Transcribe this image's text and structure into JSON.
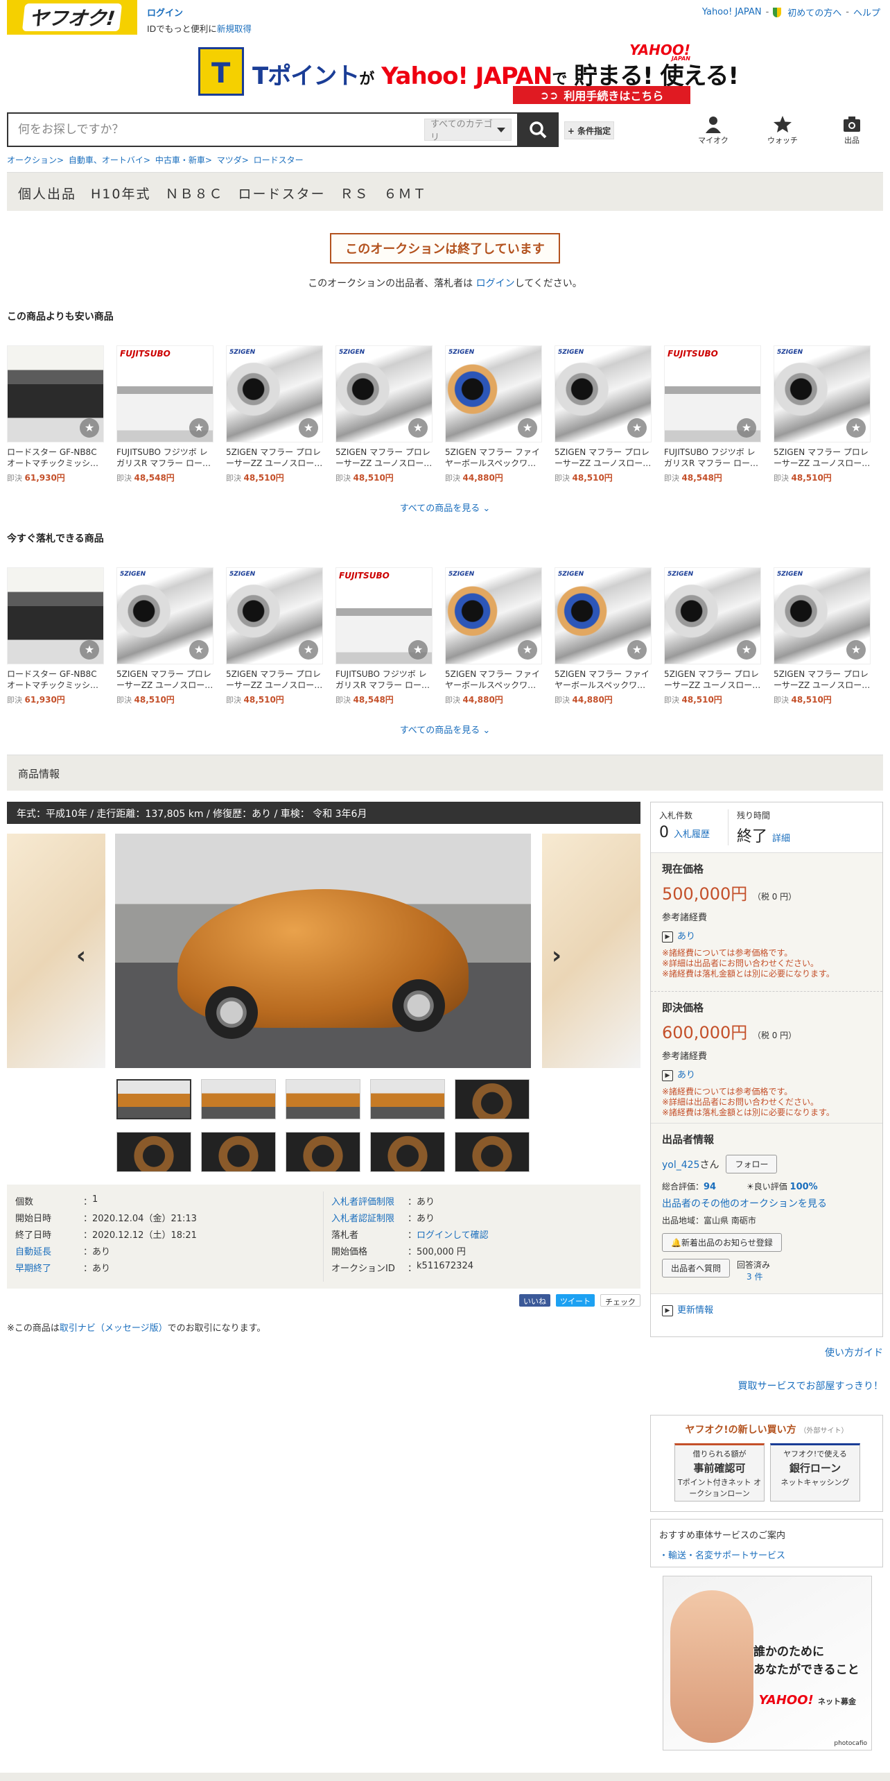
{
  "header": {
    "logo": "ヤフオク!",
    "login": "ログイン",
    "login_sub_prefix": "IDでもっと便利に",
    "login_sub_link": "新規取得",
    "top_links": [
      "Yahoo! JAPAN",
      "初めての方へ",
      "ヘルプ"
    ]
  },
  "banner": {
    "tpoint": "Tポイント",
    "ga": "が",
    "yj": "Yahoo! JAPAN",
    "de": "で",
    "tamaru": "貯まる! 使える!",
    "logo": "YAHOO!",
    "logo_sub": "JAPAN",
    "button": "利用手続きはこちら"
  },
  "search": {
    "placeholder": "何をお探しですか？",
    "category": "すべてのカテゴリ",
    "conditions": "+ 条件指定"
  },
  "nav": {
    "myauc": "マイオク",
    "watch": "ウォッチ",
    "sell": "出品"
  },
  "breadcrumbs": [
    "オークション",
    "自動車、オートバイ",
    "中古車・新車",
    "マツダ",
    "ロードスター"
  ],
  "title": "個人出品　H10年式　ＮＢ８Ｃ　ロードスター　ＲＳ　６ＭＴ",
  "ended": "このオークションは終了しています",
  "ended_note_prefix": "このオークションの出品者、落札者は",
  "ended_note_link": "ログイン",
  "ended_note_suffix": "してください。",
  "cheaper": {
    "heading": "この商品よりも安い商品",
    "more": "すべての商品を見る",
    "items": [
      {
        "title": "ロードスター GF-NB8C オートマチックミッシ…",
        "price": "61,930円",
        "art": "engine"
      },
      {
        "title": "FUJITSUBO フジツボ レガリスR マフラー ロー…",
        "price": "48,548円",
        "art": "fuji"
      },
      {
        "title": "5ZIGEN マフラー プロレーサーZZ ユーノスロー…",
        "price": "48,510円",
        "art": "muff"
      },
      {
        "title": "5ZIGEN マフラー プロレーサーZZ ユーノスロー…",
        "price": "48,510円",
        "art": "muff"
      },
      {
        "title": "5ZIGEN マフラー ファイヤーボールスペックワ…",
        "price": "44,880円",
        "art": "ti"
      },
      {
        "title": "5ZIGEN マフラー プロレーサーZZ ユーノスロー…",
        "price": "48,510円",
        "art": "muff"
      },
      {
        "title": "FUJITSUBO フジツボ レガリスR マフラー ロー…",
        "price": "48,548円",
        "art": "fuji"
      },
      {
        "title": "5ZIGEN マフラー プロレーサーZZ ユーノスロー…",
        "price": "48,510円",
        "art": "muff"
      }
    ]
  },
  "buynow": {
    "heading": "今すぐ落札できる商品",
    "more": "すべての商品を見る",
    "items": [
      {
        "title": "ロードスター GF-NB8C オートマチックミッシ…",
        "price": "61,930円",
        "art": "engine"
      },
      {
        "title": "5ZIGEN マフラー プロレーサーZZ ユーノスロー…",
        "price": "48,510円",
        "art": "muff"
      },
      {
        "title": "5ZIGEN マフラー プロレーサーZZ ユーノスロー…",
        "price": "48,510円",
        "art": "muff"
      },
      {
        "title": "FUJITSUBO フジツボ レガリスR マフラー ロー…",
        "price": "48,548円",
        "art": "fuji"
      },
      {
        "title": "5ZIGEN マフラー ファイヤーボールスペックワ…",
        "price": "44,880円",
        "art": "ti"
      },
      {
        "title": "5ZIGEN マフラー ファイヤーボールスペックワ…",
        "price": "44,880円",
        "art": "ti"
      },
      {
        "title": "5ZIGEN マフラー プロレーサーZZ ユーノスロー…",
        "price": "48,510円",
        "art": "muff"
      },
      {
        "title": "5ZIGEN マフラー プロレーサーZZ ユーノスロー…",
        "price": "48,510円",
        "art": "muff"
      }
    ]
  },
  "sokketsu": "即決",
  "info": {
    "heading": "商品情報",
    "spec": "年式：平成10年 / 走行距離：137,805 km / 修復歴：あり / 車検： 令和 3年6月",
    "left": [
      {
        "k": "個数",
        "v": "1",
        "link": false
      },
      {
        "k": "開始日時",
        "v": "2020.12.04（金）21:13",
        "link": false
      },
      {
        "k": "終了日時",
        "v": "2020.12.12（土）18:21",
        "link": false
      },
      {
        "k": "自動延長",
        "v": "あり",
        "link": true
      },
      {
        "k": "早期終了",
        "v": "あり",
        "link": true
      }
    ],
    "right": [
      {
        "k": "入札者評価制限",
        "v": "あり",
        "link": true,
        "vlink": false
      },
      {
        "k": "入札者認証制限",
        "v": "あり",
        "link": true,
        "vlink": false
      },
      {
        "k": "落札者",
        "v": "ログインして確認",
        "link": false,
        "vlink": true
      },
      {
        "k": "開始価格",
        "v": "500,000 円",
        "link": false,
        "vlink": false
      },
      {
        "k": "オークションID",
        "v": "k511672324",
        "link": false,
        "vlink": false
      }
    ],
    "social": [
      "いいね",
      "ツイート",
      "チェック"
    ],
    "note_prefix": "※この商品は",
    "note_link": "取引ナビ（メッセージ版）",
    "note_suffix": "でのお取引になります。"
  },
  "panel": {
    "bids_label": "入札件数",
    "bids": "0",
    "bid_history": "入札履歴",
    "remain_label": "残り時間",
    "remain": "終了",
    "detail": "詳細",
    "current_label": "現在価格",
    "current_price": "500,000円",
    "tax": "（税 0 円）",
    "ref_label": "参考諸経費",
    "ref_val": "あり",
    "warn1": "※諸経費については参考価格です。",
    "warn2": "※詳細は出品者にお問い合わせください。",
    "warn3": "※諸経費は落札金額とは別に必要になります。",
    "buynow_label": "即決価格",
    "buynow_price": "600,000円",
    "seller_label": "出品者情報",
    "seller": "yol_425",
    "san": "さん",
    "follow": "フォロー",
    "rating_label": "総合評価：",
    "rating": "94",
    "good_label": "良い評価",
    "good": "100%",
    "other": "出品者のその他のオークションを見る",
    "region": "出品地域：富山県 南砺市",
    "notify": "新着出品のお知らせ登録",
    "ask": "出品者へ質問",
    "answered": "回答済み",
    "answered_count": "3 件",
    "update": "更新情報"
  },
  "right": {
    "guide": "使い方ガイド",
    "kaitori": "買取サービスでお部屋すっきり！",
    "newway": "ヤフオク!の新しい買い方",
    "external": "（外部サイト）",
    "card1_top": "借りられる額が",
    "card1_big": "事前確認可",
    "card1_sub": "Tポイント付きネット オークションローン",
    "card2_top": "ヤフオク!で使える",
    "card2_big": "銀行ローン",
    "card2_sub": "ネットキャッシング",
    "svc_title": "おすすめ車体サービスのご案内",
    "svc_link": "・輸送・名変サポートサービス",
    "ad_line1": "誰かのために",
    "ad_line2": "あなたができること",
    "ad_logo": "YAHOO!",
    "ad_sub": "ネット募金",
    "ad_credit": "photocafio"
  }
}
